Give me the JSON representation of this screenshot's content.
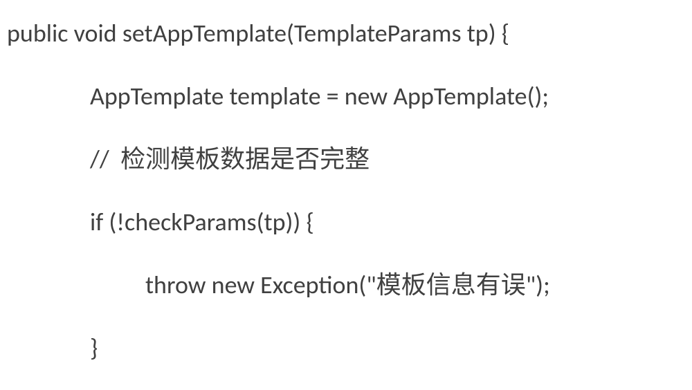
{
  "code": {
    "line1": "public void setAppTemplate(TemplateParams tp) {",
    "line2": "AppTemplate template = new AppTemplate();",
    "line3": "//  检测模板数据是否完整",
    "line4": "if (!checkParams(tp)) {",
    "line5": "throw new Exception(\"模板信息有误\");",
    "line6": "}"
  }
}
